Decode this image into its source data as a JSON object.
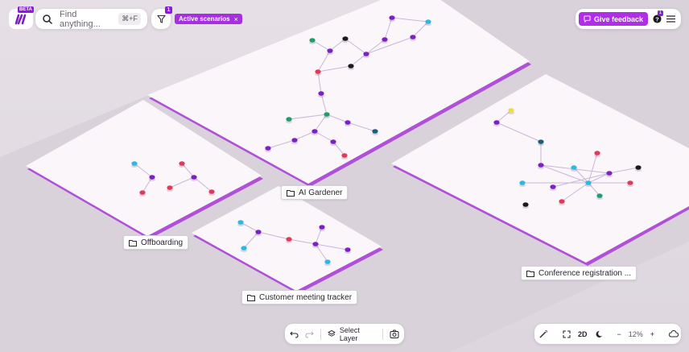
{
  "app": {
    "beta_label": "BETA"
  },
  "search": {
    "placeholder": "Find anything...",
    "shortcut": "⌘+F"
  },
  "filter": {
    "count": "1",
    "active_chip": "Active scenarios",
    "chip_close": "×"
  },
  "top_right": {
    "feedback_label": "Give feedback",
    "help_count": "1"
  },
  "scenarios": [
    {
      "name": "AI Gardener"
    },
    {
      "name": "Offboarding"
    },
    {
      "name": "Customer meeting tracker"
    },
    {
      "name": "Conference registration ..."
    }
  ],
  "bottom_toolbar": {
    "select_layer_label": "Select Layer"
  },
  "view_controls": {
    "mode": "2D",
    "zoom": "12%",
    "zoom_out": "−",
    "zoom_in": "+"
  },
  "colors": {
    "accent": "#a52fe3",
    "node_purple": "#7d1fc4",
    "node_green": "#1f9e6a",
    "node_blue": "#2db8e0",
    "node_teal": "#1a5f7a",
    "node_red": "#e0395a",
    "node_yellow": "#e8e040",
    "node_black": "#1a1a1a"
  }
}
